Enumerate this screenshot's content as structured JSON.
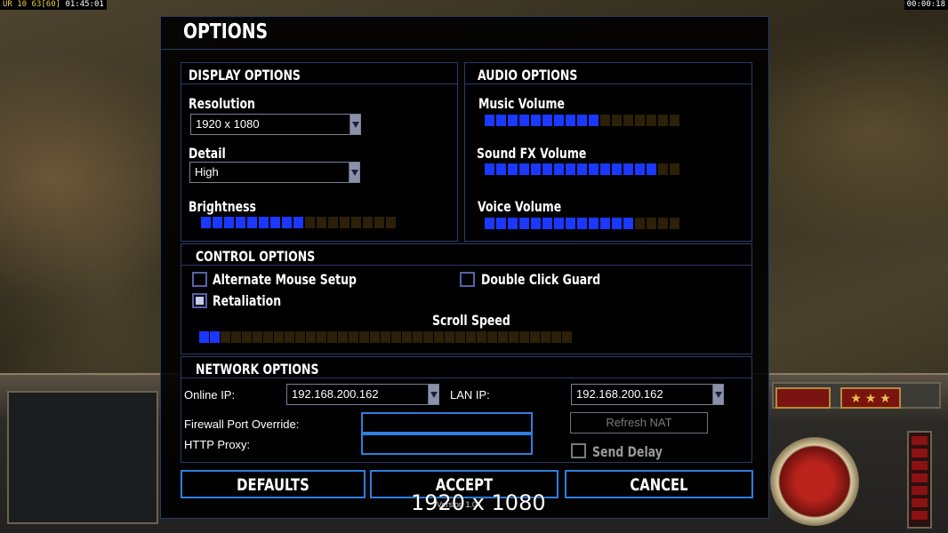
{
  "hud": {
    "left_prefix": "UR",
    "left_values": "10 63",
    "left_bracket": "[60]",
    "left_time": "01:45:01",
    "right_time": "00:00:18"
  },
  "colors": {
    "slider_on": "#1a38ff",
    "slider_off": "#2c2008",
    "panel_border": "#2a3a6a",
    "button_border": "#2e7fe0"
  },
  "window": {
    "title": "OPTIONS"
  },
  "display": {
    "heading": "DISPLAY OPTIONS",
    "resolution_label": "Resolution",
    "resolution_value": "1920 x 1080",
    "detail_label": "Detail",
    "detail_value": "High",
    "brightness_label": "Brightness",
    "brightness_level": 9,
    "brightness_total": 17
  },
  "audio": {
    "heading": "AUDIO OPTIONS",
    "music_label": "Music Volume",
    "music_level": 10,
    "music_total": 17,
    "sfx_label": "Sound FX Volume",
    "sfx_level": 15,
    "sfx_total": 17,
    "voice_label": "Voice Volume",
    "voice_level": 13,
    "voice_total": 17
  },
  "control": {
    "heading": "CONTROL OPTIONS",
    "alt_mouse_label": "Alternate Mouse Setup",
    "alt_mouse_checked": false,
    "double_click_label": "Double Click Guard",
    "double_click_checked": false,
    "retaliation_label": "Retaliation",
    "retaliation_checked": true,
    "scroll_speed_label": "Scroll Speed",
    "scroll_level": 2,
    "scroll_total": 35
  },
  "network": {
    "heading": "NETWORK OPTIONS",
    "online_ip_label": "Online IP:",
    "online_ip_value": "192.168.200.162",
    "lan_ip_label": "LAN IP:",
    "lan_ip_value": "192.168.200.162",
    "firewall_label": "Firewall Port Override:",
    "firewall_value": "",
    "http_proxy_label": "HTTP Proxy:",
    "http_proxy_value": "",
    "refresh_nat_label": "Refresh NAT",
    "send_delay_label": "Send Delay",
    "send_delay_checked": false
  },
  "buttons": {
    "defaults": "DEFAULTS",
    "accept": "ACCEPT",
    "cancel": "CANCEL"
  },
  "version_text": "Version 1.04",
  "overlay_resolution": "1920 x 1080"
}
